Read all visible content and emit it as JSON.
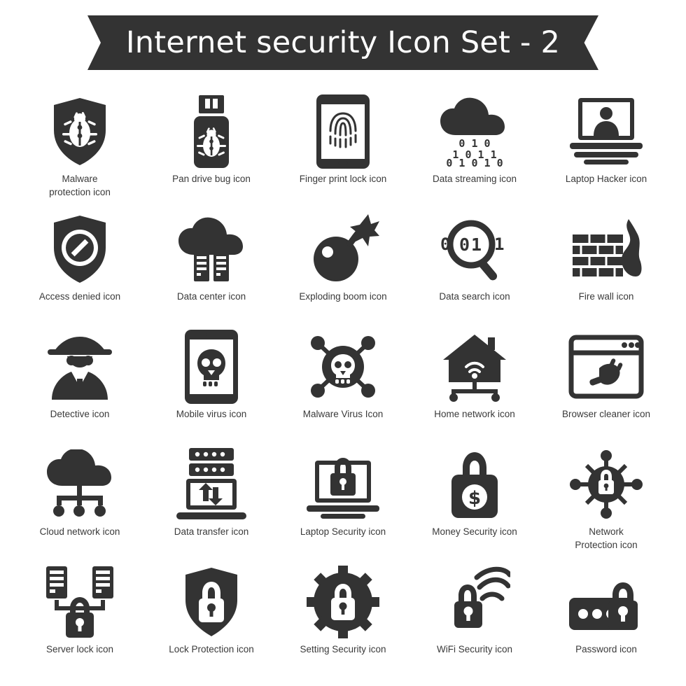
{
  "banner": {
    "title": "Internet security Icon Set - 2",
    "background": "#333333",
    "text_color": "#ffffff"
  },
  "theme": {
    "icon_color": "#333333",
    "caption_color": "#3a3a3a",
    "page_background": "#ffffff"
  },
  "grid": {
    "columns": 5,
    "rows": 5
  },
  "icons": [
    {
      "name": "malware-protection-icon",
      "label": "Malware\nprotection icon",
      "label_line1": "Malware",
      "label_line2": "protection icon"
    },
    {
      "name": "pan-drive-bug-icon",
      "label": "Pan drive bug icon",
      "label_line1": "Pan drive bug icon",
      "label_line2": ""
    },
    {
      "name": "finger-print-lock-icon",
      "label": "Finger print lock icon",
      "label_line1": "Finger print lock icon",
      "label_line2": ""
    },
    {
      "name": "data-streaming-icon",
      "label": "Data streaming icon",
      "label_line1": "Data streaming icon",
      "label_line2": ""
    },
    {
      "name": "laptop-hacker-icon",
      "label": "Laptop Hacker icon",
      "label_line1": "Laptop Hacker icon",
      "label_line2": ""
    },
    {
      "name": "access-denied-icon",
      "label": "Access denied icon",
      "label_line1": "Access denied icon",
      "label_line2": ""
    },
    {
      "name": "data-center-icon",
      "label": "Data center icon",
      "label_line1": "Data center icon",
      "label_line2": ""
    },
    {
      "name": "exploding-boom-icon",
      "label": "Exploding boom icon",
      "label_line1": "Exploding boom icon",
      "label_line2": ""
    },
    {
      "name": "data-search-icon",
      "label": "Data search icon",
      "label_line1": "Data search icon",
      "label_line2": ""
    },
    {
      "name": "fire-wall-icon",
      "label": "Fire wall icon",
      "label_line1": "Fire wall icon",
      "label_line2": ""
    },
    {
      "name": "detective-icon",
      "label": "Detective icon",
      "label_line1": "Detective icon",
      "label_line2": ""
    },
    {
      "name": "mobile-virus-icon",
      "label": "Mobile virus icon",
      "label_line1": "Mobile virus icon",
      "label_line2": ""
    },
    {
      "name": "malware-virus-icon",
      "label": "Malware Virus Icon",
      "label_line1": "Malware Virus Icon",
      "label_line2": ""
    },
    {
      "name": "home-network-icon",
      "label": "Home network icon",
      "label_line1": "Home network icon",
      "label_line2": ""
    },
    {
      "name": "browser-cleaner-icon",
      "label": "Browser cleaner icon",
      "label_line1": "Browser cleaner icon",
      "label_line2": ""
    },
    {
      "name": "cloud-network-icon",
      "label": "Cloud network icon",
      "label_line1": "Cloud network icon",
      "label_line2": ""
    },
    {
      "name": "data-transfer-icon",
      "label": "Data transfer icon",
      "label_line1": "Data transfer icon",
      "label_line2": ""
    },
    {
      "name": "laptop-security-icon",
      "label": "Laptop Security icon",
      "label_line1": "Laptop Security icon",
      "label_line2": ""
    },
    {
      "name": "money-security-icon",
      "label": "Money Security icon",
      "label_line1": "Money Security icon",
      "label_line2": ""
    },
    {
      "name": "network-protection-icon",
      "label": "Network\nProtection icon",
      "label_line1": "Network",
      "label_line2": "Protection icon"
    },
    {
      "name": "server-lock-icon",
      "label": "Server lock icon",
      "label_line1": "Server lock icon",
      "label_line2": ""
    },
    {
      "name": "lock-protection-icon",
      "label": "Lock Protection icon",
      "label_line1": "Lock Protection icon",
      "label_line2": ""
    },
    {
      "name": "setting-security-icon",
      "label": "Setting Security icon",
      "label_line1": "Setting Security icon",
      "label_line2": ""
    },
    {
      "name": "wifi-security-icon",
      "label": "WiFi Security icon",
      "label_line1": "WiFi Security icon",
      "label_line2": ""
    },
    {
      "name": "password-icon",
      "label": "Password icon",
      "label_line1": "Password icon",
      "label_line2": ""
    }
  ],
  "data_streaming_digits": [
    "0 1 0",
    "1 0 1 1",
    "0 1 0 1 0"
  ],
  "data_search_digits": "0  0 1 1"
}
